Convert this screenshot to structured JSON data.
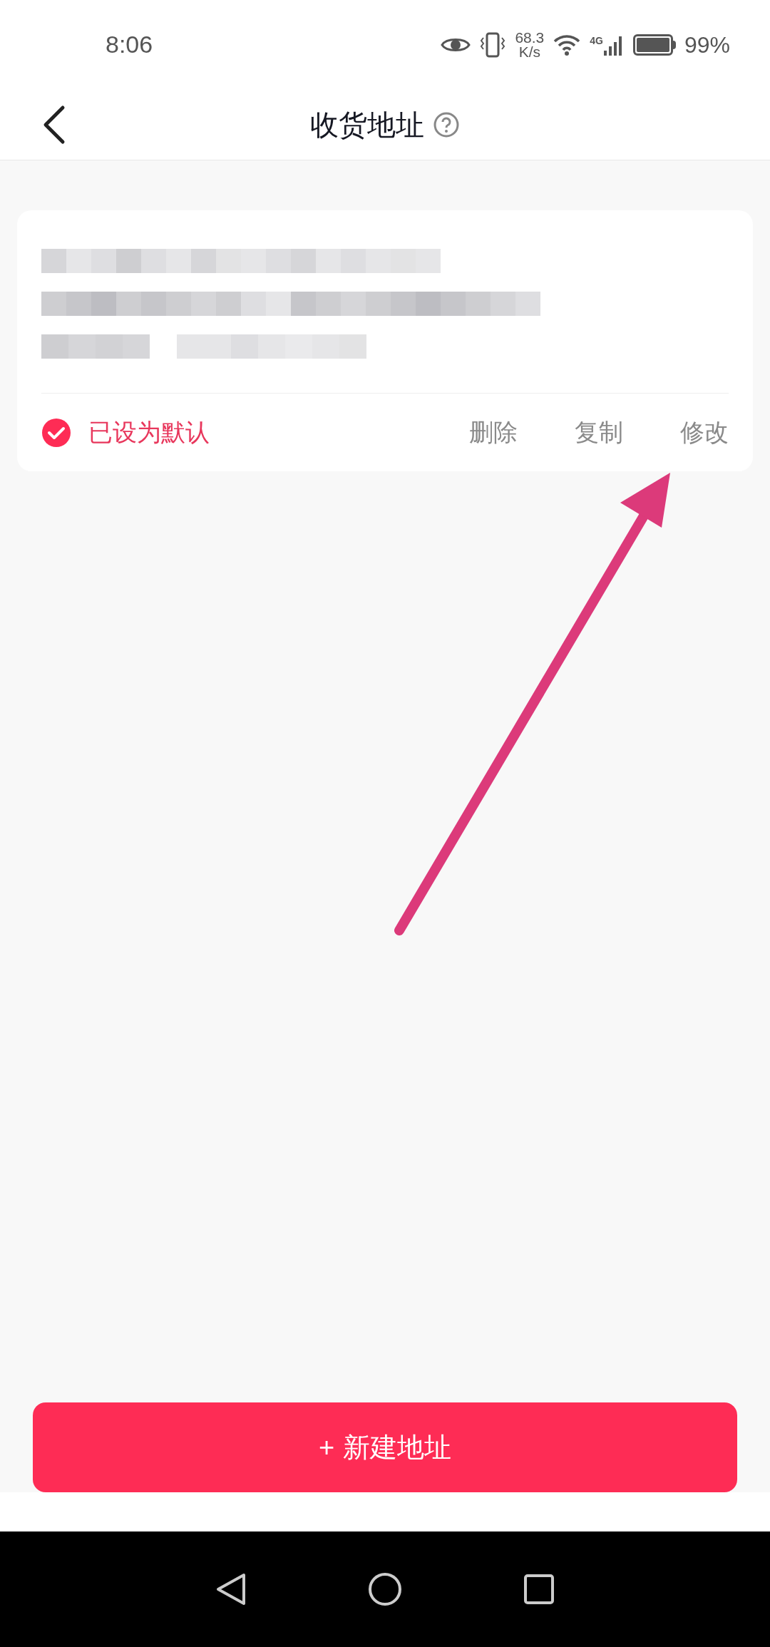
{
  "status_bar": {
    "time": "8:06",
    "net_speed_value": "68.3",
    "net_speed_unit": "K/s",
    "network": "4G",
    "battery": "99%"
  },
  "header": {
    "title": "收货地址"
  },
  "address_card": {
    "default_label": "已设为默认",
    "is_default": true,
    "actions": [
      "删除",
      "复制",
      "修改"
    ]
  },
  "new_button": {
    "icon": "+",
    "label": "新建地址"
  }
}
